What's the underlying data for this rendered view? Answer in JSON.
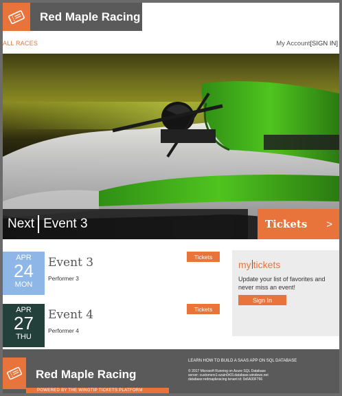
{
  "header": {
    "brand_name": "Red Maple Racing",
    "logo_icon": "ticket-icon",
    "nav_all_races": "ALL RACES",
    "my_account": "My Account",
    "sign_in": "[SIGN IN]"
  },
  "hero": {
    "image": "green race car on track",
    "next_label": "Next",
    "next_event": "Event 3",
    "tickets_label": "Tickets",
    "tickets_arrow": ">"
  },
  "events": [
    {
      "month": "APR",
      "day": "24",
      "weekday": "MON",
      "title": "Event 3",
      "performer": "Performer 3",
      "tickets_label": "Tickets",
      "color": "#8eb6e6"
    },
    {
      "month": "APR",
      "day": "27",
      "weekday": "THU",
      "title": "Event 4",
      "performer": "Performer 4",
      "tickets_label": "Tickets",
      "color": "#24403b"
    }
  ],
  "my_tickets": {
    "title_my": "my",
    "title_tickets": "tickets",
    "description": "Update your list of favorites and never miss an event!",
    "sign_in_label": "Sign In"
  },
  "footer": {
    "brand_name": "Red Maple Racing",
    "powered_by": "POWERED BY THE WINGTIP TICKETS PLATFORM",
    "learn_link": "LEARN HOW TO BUILD A SAAS APP ON SQL DATABASE",
    "copyright": "© 2017 Microsoft Running on Azure SQL Database",
    "server": "server: customers1-szain0r03.database.windows.net",
    "database": "database:redmapleracing tenant id: 0x6A30F766"
  },
  "colors": {
    "accent": "#e8743b",
    "header_bg": "#5a5a5a",
    "panel_bg": "#ececec"
  }
}
